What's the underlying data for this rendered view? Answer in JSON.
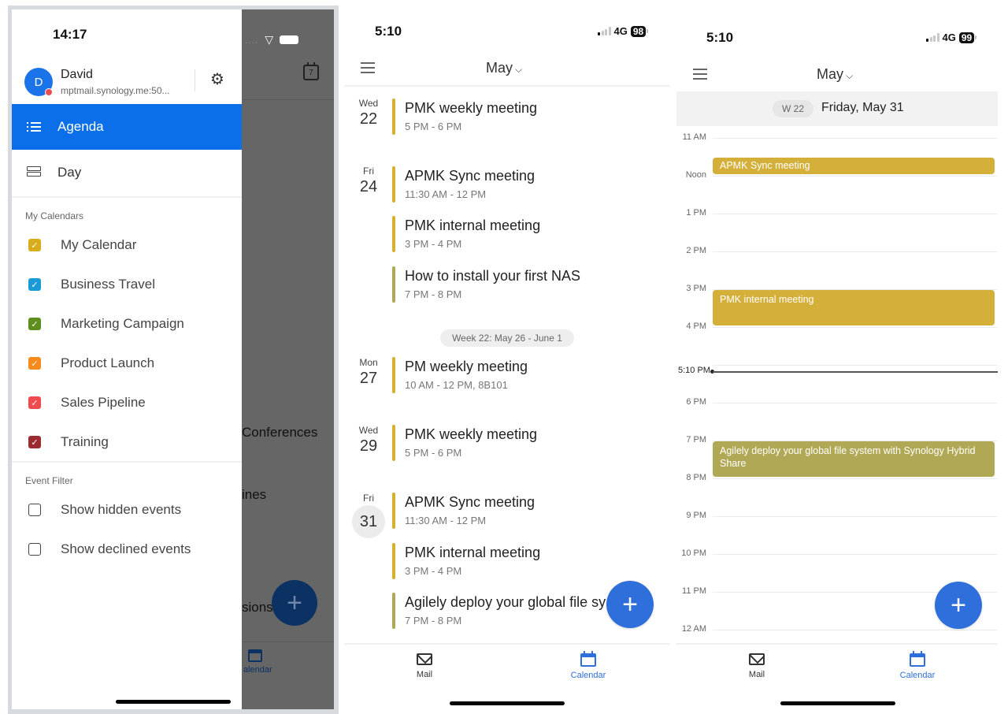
{
  "drawer_screen": {
    "status_time": "14:17",
    "account": {
      "initial": "D",
      "name": "David",
      "host": "mptmail.synology.me:50..."
    },
    "nav": [
      {
        "label": "Agenda",
        "icon": "list-icon",
        "active": true
      },
      {
        "label": "Day",
        "icon": "day-view-icon",
        "active": false
      }
    ],
    "my_calendars_label": "My Calendars",
    "calendars": [
      {
        "label": "My Calendar",
        "color": "#d9ac1c",
        "checked": true
      },
      {
        "label": "Business Travel",
        "color": "#1a9bd7",
        "checked": true
      },
      {
        "label": "Marketing Campaign",
        "color": "#5e8f1e",
        "checked": true
      },
      {
        "label": "Product Launch",
        "color": "#f78a1d",
        "checked": true
      },
      {
        "label": "Sales Pipeline",
        "color": "#ee4a50",
        "checked": true
      },
      {
        "label": "Training",
        "color": "#9b2a31",
        "checked": true
      }
    ],
    "event_filter_label": "Event Filter",
    "filters": [
      {
        "label": "Show hidden events",
        "checked": false
      },
      {
        "label": "Show declined events",
        "checked": false
      }
    ],
    "background": {
      "calendar_icon_day": "7",
      "partial_texts": [
        "Conferences",
        "ines",
        "sions"
      ],
      "tab_label_partial": "alendar"
    }
  },
  "agenda_screen": {
    "status_time": "5:10",
    "network": "4G",
    "battery": "98",
    "month": "May",
    "days": [
      {
        "dow": "Wed",
        "day": "22",
        "today": false,
        "events": [
          {
            "title": "PMK weekly meeting",
            "time": "5 PM - 6 PM",
            "color": "#d8b030"
          }
        ]
      },
      {
        "dow": "Fri",
        "day": "24",
        "today": false,
        "events": [
          {
            "title": "APMK Sync meeting",
            "time": "11:30 AM - 12 PM",
            "color": "#d8b030"
          },
          {
            "title": "PMK internal meeting",
            "time": "3 PM - 4 PM",
            "color": "#d8b030"
          },
          {
            "title": "How to install your first NAS",
            "time": "7 PM - 8 PM",
            "color": "#b0a857"
          }
        ]
      },
      {
        "dow": "Mon",
        "day": "27",
        "today": false,
        "events": [
          {
            "title": "PM weekly meeting",
            "time": "10 AM - 12 PM, 8B101",
            "color": "#d8b030"
          }
        ]
      },
      {
        "dow": "Wed",
        "day": "29",
        "today": false,
        "events": [
          {
            "title": "PMK weekly meeting",
            "time": "5 PM - 6 PM",
            "color": "#d8b030"
          }
        ]
      },
      {
        "dow": "Fri",
        "day": "31",
        "today": true,
        "events": [
          {
            "title": "APMK Sync meeting",
            "time": "11:30 AM - 12 PM",
            "color": "#d8b030"
          },
          {
            "title": "PMK internal meeting",
            "time": "3 PM - 4 PM",
            "color": "#d8b030"
          },
          {
            "title": "Agilely deploy your global file sy",
            "time": "7 PM - 8 PM",
            "color": "#b0a857"
          }
        ]
      }
    ],
    "week_separator": "Week 22: May 26 - June 1",
    "tabs": [
      {
        "label": "Mail",
        "active": false
      },
      {
        "label": "Calendar",
        "active": true
      }
    ],
    "fab_label": "+"
  },
  "day_screen": {
    "status_time": "5:10",
    "network": "4G",
    "battery": "99",
    "month": "May",
    "week_badge": "W 22",
    "date_title": "Friday, May 31",
    "hours": [
      "11 AM",
      "Noon",
      "1 PM",
      "2 PM",
      "3 PM",
      "4 PM",
      "5 PM",
      "6 PM",
      "7 PM",
      "8 PM",
      "9 PM",
      "10 PM",
      "11 PM",
      "12 AM"
    ],
    "now_label": "5:10 PM",
    "events": [
      {
        "title": "APMK Sync meeting",
        "start": 11.5,
        "end": 12,
        "color": "#d4af3a"
      },
      {
        "title": "PMK internal meeting",
        "start": 15,
        "end": 16,
        "color": "#d4af3a"
      },
      {
        "title": "Agilely deploy your global file system with Synology Hybrid Share",
        "start": 19,
        "end": 20,
        "color": "#b1a855"
      }
    ],
    "tabs": [
      {
        "label": "Mail",
        "active": false
      },
      {
        "label": "Calendar",
        "active": true
      }
    ],
    "fab_label": "+"
  }
}
